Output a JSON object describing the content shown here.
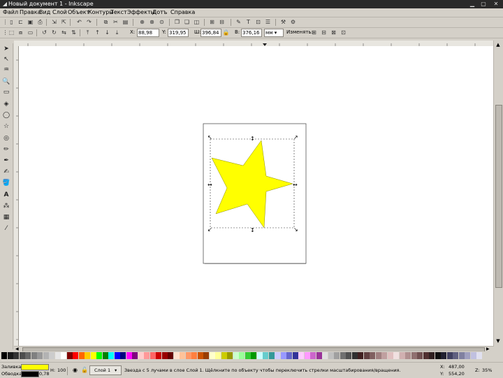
{
  "window": {
    "title": "Новый документ 1 - Inkscape"
  },
  "menu": [
    "Файл",
    "Правка",
    "Вид",
    "Слой",
    "Объект",
    "Контуры",
    "Текст",
    "Эффекты",
    "Дотъ",
    "Справка"
  ],
  "toolbar2": {
    "x_label": "X:",
    "x_value": "88,98",
    "y_label": "Y:",
    "y_value": "319,95",
    "w_label": "Ш:",
    "w_value": "396,84",
    "h_label": "В:",
    "h_value": "376,16",
    "units": "мм",
    "affect_label": "Изменять:"
  },
  "canvas": {
    "star_fill": "#ffff00",
    "star_stroke": "#888800"
  },
  "palette": [
    "#000000",
    "#1a1a1a",
    "#333333",
    "#4d4d4d",
    "#666666",
    "#808080",
    "#999999",
    "#b3b3b3",
    "#cccccc",
    "#e6e6e6",
    "#ffffff",
    "#800000",
    "#ff0000",
    "#ff6600",
    "#ffcc00",
    "#ffff00",
    "#00ff00",
    "#008000",
    "#00ffff",
    "#0000ff",
    "#000080",
    "#ff00ff",
    "#800080",
    "#ffcccc",
    "#ff9999",
    "#ff6666",
    "#cc0000",
    "#990000",
    "#660000",
    "#ffe0cc",
    "#ffc299",
    "#ff9966",
    "#ff8040",
    "#cc5200",
    "#993d00",
    "#ffffcc",
    "#ffff99",
    "#cccc00",
    "#999900",
    "#ccffcc",
    "#99ff99",
    "#33cc33",
    "#009900",
    "#ccffff",
    "#66cccc",
    "#339999",
    "#ccccff",
    "#9999ff",
    "#6666cc",
    "#333399",
    "#ffccff",
    "#ff99ff",
    "#cc66cc",
    "#993399",
    "#e0e0e0",
    "#c0c0c0",
    "#a0a0a0",
    "#707070",
    "#505050",
    "#303030",
    "#402020",
    "#604040",
    "#806060",
    "#a08080",
    "#c0a0a0",
    "#e0c0c0",
    "#f0e0e0",
    "#d0b0b0",
    "#b09090",
    "#907070",
    "#705050",
    "#503030",
    "#302020",
    "#101010",
    "#202030",
    "#404060",
    "#606080",
    "#8080a0",
    "#a0a0c0",
    "#c0c0e0",
    "#e0e0f0"
  ],
  "status": {
    "fill_label": "Заливка:",
    "stroke_label": "Обводка:",
    "fill_color": "#ffff00",
    "stroke_color": "#000000",
    "stroke_width": "0,78",
    "opacity_label": "Н:",
    "opacity_value": "100",
    "layer_label": "Слой 1",
    "message": "Звезда с 5 лучами в слое Слой 1. Щёлкните по объекту чтобы переключить стрелки масштабирования/вращения.",
    "x_label": "X:",
    "x_value": "487,00",
    "y_label": "Y:",
    "y_value": "554,20",
    "z_label": "Z:",
    "z_value": "35%"
  }
}
